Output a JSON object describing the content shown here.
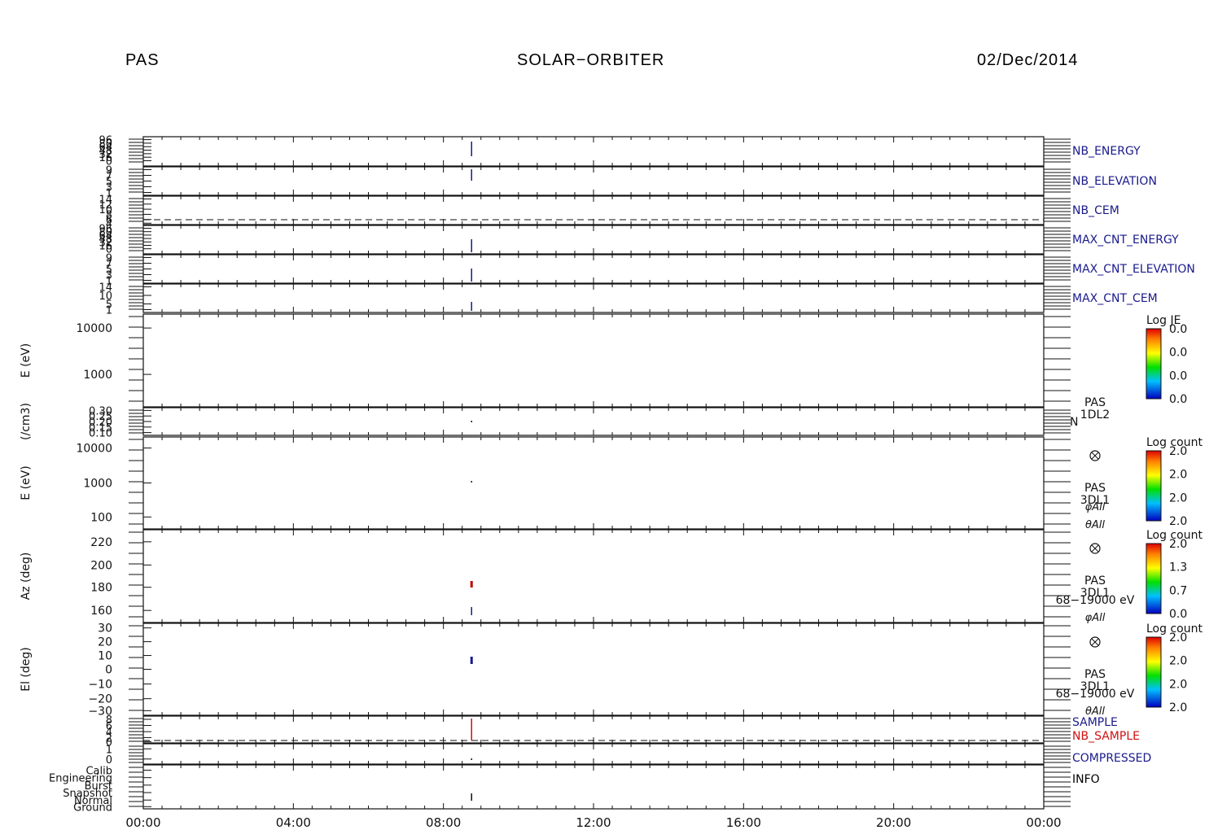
{
  "header": {
    "left": "PAS",
    "center": "SOLAR−ORBITER",
    "right": "02/Dec/2014"
  },
  "chart_data": [
    {
      "type": "line",
      "name": "NB_ENERGY",
      "label": "NB_ENERGY",
      "label_color": "#1a1a8c",
      "y_ticks": [
        "96",
        "80",
        "64",
        "48",
        "32",
        "16",
        "0"
      ]
    },
    {
      "type": "line",
      "name": "NB_ELEVATION",
      "label": "NB_ELEVATION",
      "label_color": "#1a1a8c",
      "y_ticks": [
        "9",
        "7",
        "5",
        "3",
        "1"
      ]
    },
    {
      "type": "line",
      "name": "NB_CEM",
      "label": "NB_CEM",
      "label_color": "#1a1a8c",
      "y_ticks": [
        "14",
        "12",
        "10",
        "8",
        "6",
        "4"
      ]
    },
    {
      "type": "line",
      "name": "MAX_CNT_ENERGY",
      "label": "MAX_CNT_ENERGY",
      "label_color": "#1a1a8c",
      "y_ticks": [
        "96",
        "80",
        "64",
        "48",
        "32",
        "16",
        "0"
      ]
    },
    {
      "type": "line",
      "name": "MAX_CNT_ELEVATION",
      "label": "MAX_CNT_ELEVATION",
      "label_color": "#1a1a8c",
      "y_ticks": [
        "9",
        "7",
        "5",
        "3",
        "1"
      ]
    },
    {
      "type": "line",
      "name": "MAX_CNT_CEM",
      "label": "MAX_CNT_CEM",
      "label_color": "#1a1a8c",
      "y_ticks": [
        "14",
        "10",
        "5",
        "1"
      ]
    },
    {
      "type": "heatmap",
      "ylabel": "E (eV)",
      "y_scale": "log",
      "y_ticks": [
        "10000",
        "1000"
      ],
      "colorbar": {
        "title": "Log JE",
        "ticks": [
          "0.0",
          "0.0",
          "0.0",
          "0.0"
        ]
      }
    },
    {
      "type": "line",
      "ylabel": "(/cm3)",
      "y_ticks": [
        "0.30",
        "0.25",
        "0.20",
        "0.15",
        "0.10"
      ],
      "side_labels": [
        "PAS",
        "1DL2",
        "N"
      ]
    },
    {
      "type": "heatmap",
      "ylabel": "E (eV)",
      "y_scale": "log",
      "y_ticks": [
        "10000",
        "1000",
        "100"
      ],
      "colorbar": {
        "title": "Log count",
        "ticks": [
          "2.0",
          "2.0",
          "2.0",
          "2.0"
        ]
      },
      "side_labels": [
        "PAS",
        "3DL1",
        "φAll",
        "θAll"
      ]
    },
    {
      "type": "heatmap",
      "ylabel": "Az (deg)",
      "y_ticks": [
        "220",
        "200",
        "180",
        "160"
      ],
      "colorbar": {
        "title": "Log count",
        "ticks": [
          "2.0",
          "1.3",
          "0.7",
          "0.0"
        ]
      },
      "side_labels": [
        "PAS",
        "3DL1",
        "68−19000 eV",
        "φAll"
      ]
    },
    {
      "type": "heatmap",
      "ylabel": "El (deg)",
      "y_ticks": [
        "30",
        "20",
        "10",
        "0",
        "−10",
        "−20",
        "−30"
      ],
      "colorbar": {
        "title": "Log count",
        "ticks": [
          "2.0",
          "2.0",
          "2.0",
          "2.0"
        ]
      },
      "side_labels": [
        "PAS",
        "3DL1",
        "68−19000 eV",
        "θAll"
      ]
    },
    {
      "type": "line",
      "name": "SAMPLE / NB_SAMPLE",
      "y_ticks": [
        "8",
        "6",
        "4",
        "2",
        "0"
      ],
      "series": [
        {
          "name": "SAMPLE",
          "color": "#1a1a8c"
        },
        {
          "name": "NB_SAMPLE",
          "color": "#d01010"
        }
      ]
    },
    {
      "type": "line",
      "name": "COMPRESSED",
      "label": "COMPRESSED",
      "label_color": "#1a1a8c",
      "y_ticks": [
        "1",
        "0"
      ]
    },
    {
      "type": "line",
      "name": "INFO",
      "label": "INFO",
      "label_color": "#000000",
      "y_ticks": [
        "Calib",
        "Engineering",
        "Burst",
        "Snapshot",
        "Normal",
        "Ground"
      ]
    }
  ],
  "x_axis": {
    "ticks": [
      "00:00",
      "04:00",
      "08:00",
      "12:00",
      "16:00",
      "20:00",
      "00:00"
    ],
    "range_hours": [
      0,
      24
    ]
  },
  "marker_color": "#d01010"
}
